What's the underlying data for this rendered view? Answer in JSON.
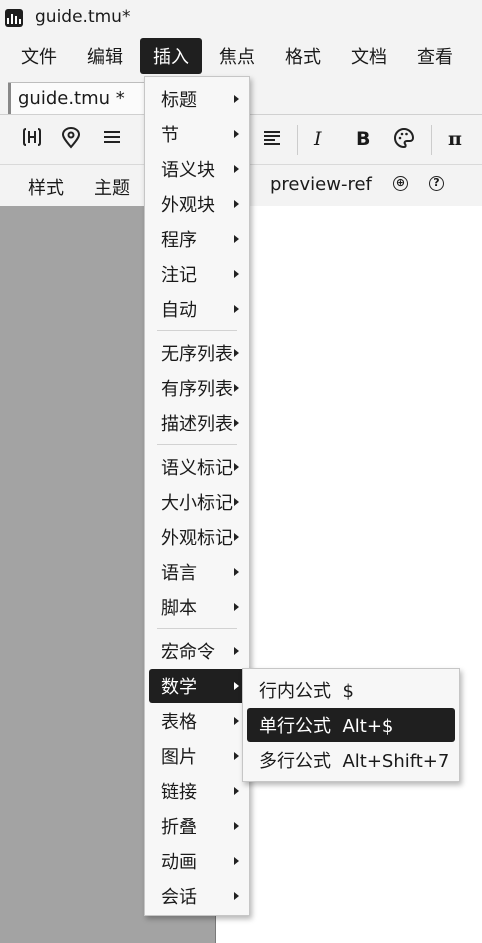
{
  "window": {
    "title": "guide.tmu*"
  },
  "menubar": [
    "文件",
    "编辑",
    "插入",
    "焦点",
    "格式",
    "文档",
    "查看"
  ],
  "tab": {
    "label": "guide.tmu *"
  },
  "toolbar": {
    "italic_label": "I",
    "bold_label": "B",
    "pi_label": "π"
  },
  "subbar": {
    "style_label": "样式",
    "theme_label": "主题",
    "preview_ref_label": "preview-ref",
    "plus_glyph": "⊕",
    "help_glyph": "?"
  },
  "insert_menu": {
    "items": [
      {
        "label": "标题"
      },
      {
        "label": "节"
      },
      {
        "label": "语义块"
      },
      {
        "label": "外观块"
      },
      {
        "label": "程序"
      },
      {
        "label": "注记"
      },
      {
        "label": "自动"
      },
      {
        "label": "无序列表"
      },
      {
        "label": "有序列表"
      },
      {
        "label": "描述列表"
      },
      {
        "label": "语义标记"
      },
      {
        "label": "大小标记"
      },
      {
        "label": "外观标记"
      },
      {
        "label": "语言"
      },
      {
        "label": "脚本"
      },
      {
        "label": "宏命令"
      },
      {
        "label": "数学"
      },
      {
        "label": "表格"
      },
      {
        "label": "图片"
      },
      {
        "label": "链接"
      },
      {
        "label": "折叠"
      },
      {
        "label": "动画"
      },
      {
        "label": "会话"
      }
    ]
  },
  "math_submenu": {
    "items": [
      {
        "label": "行内公式  $"
      },
      {
        "label": "单行公式  Alt+$"
      },
      {
        "label": "多行公式  Alt+Shift+7"
      }
    ]
  }
}
